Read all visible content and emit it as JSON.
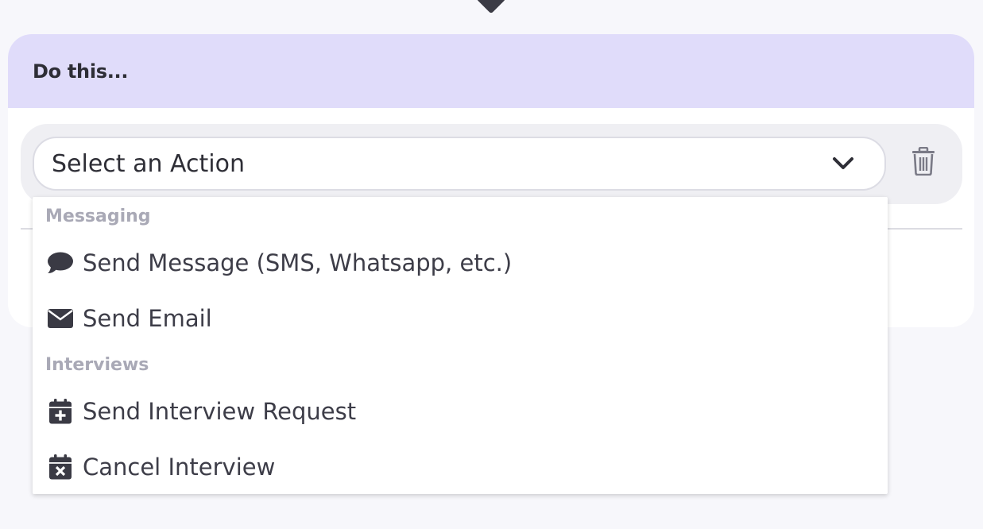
{
  "card": {
    "title": "Do this..."
  },
  "action_select": {
    "value": "Select an Action",
    "icons": {
      "chevron": "chevron-down-icon",
      "delete": "trash-icon"
    }
  },
  "dropdown": {
    "groups": [
      {
        "label": "Messaging",
        "items": [
          {
            "label": "Send Message (SMS, Whatsapp, etc.)",
            "icon": "chat-bubble-icon"
          },
          {
            "label": "Send Email",
            "icon": "envelope-icon"
          }
        ]
      },
      {
        "label": "Interviews",
        "items": [
          {
            "label": "Send Interview Request",
            "icon": "calendar-plus-icon"
          },
          {
            "label": "Cancel Interview",
            "icon": "calendar-x-icon"
          }
        ]
      }
    ]
  },
  "colors": {
    "header_bg": "#e0dcfa",
    "page_bg": "#f7f7fb",
    "text_dark": "#2e2e36",
    "group_label": "#a9a9b6"
  }
}
